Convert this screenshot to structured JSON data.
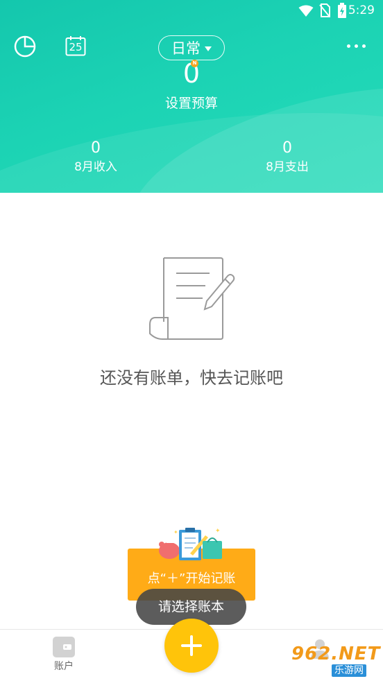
{
  "statusbar": {
    "time": "5:29",
    "icons": [
      "wifi-icon",
      "no-sim-icon",
      "battery-charging-icon"
    ]
  },
  "header": {
    "left_icons": [
      "pie-chart-icon",
      "calendar-icon"
    ],
    "calendar_day": "25",
    "book_name": "日常",
    "more_icon": "more-dots-icon",
    "budget_value": "0",
    "budget_badge": "N",
    "budget_label": "设置预算",
    "income_value": "0",
    "income_label": "8月收入",
    "expense_value": "0",
    "expense_label": "8月支出",
    "gradient_colors": [
      "#14c7ad",
      "#25dbb9"
    ]
  },
  "main": {
    "empty_icon": "empty-bill-icon",
    "empty_text": "还没有账单，快去记账吧"
  },
  "start_card": {
    "label": "点“＋”开始记账",
    "color": "#ffab17"
  },
  "toast": {
    "message": "请选择账本"
  },
  "tabbar": {
    "account_label": "账户",
    "account_icon": "wallet-icon",
    "add_icon": "plus-icon",
    "add_color": "#ffc40a",
    "mine_icon": "user-icon"
  },
  "watermark": {
    "main": "962.NET",
    "sub": "乐游网"
  }
}
